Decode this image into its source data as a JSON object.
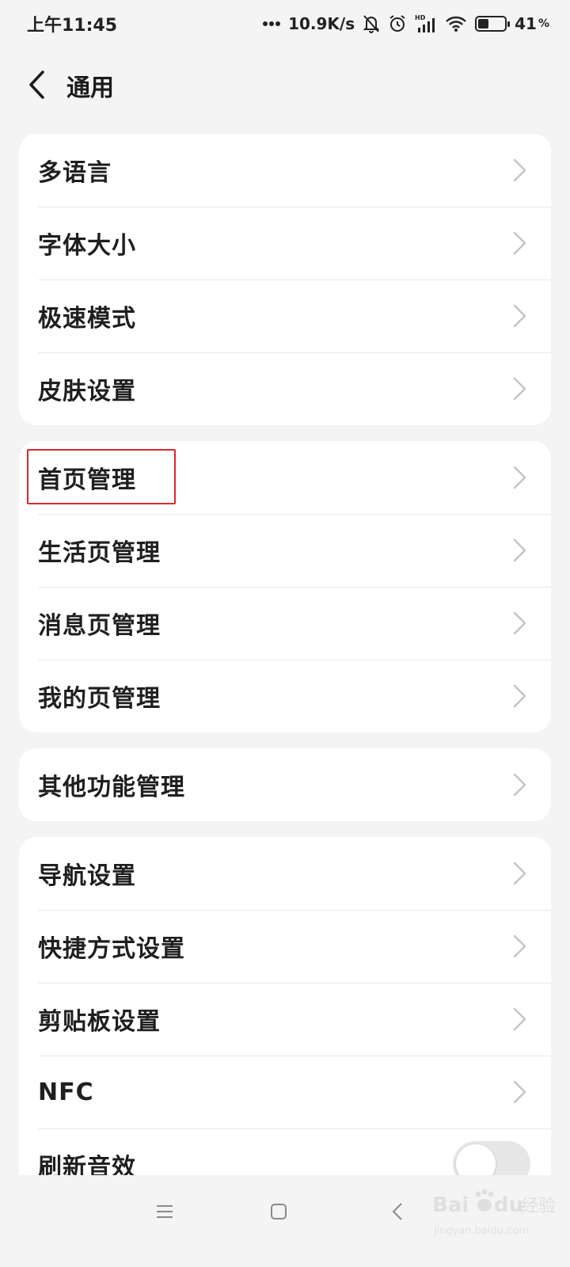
{
  "status_bar": {
    "time": "上午11:45",
    "network_speed": "10.9K/s",
    "battery_level": 41,
    "battery_text": "41",
    "percent_sign": "%",
    "icons": [
      "dots-icon",
      "mute-bell-icon",
      "alarm-icon",
      "hd-signal-icon",
      "wifi-icon",
      "battery-icon"
    ]
  },
  "header": {
    "title": "通用",
    "back_icon": "chevron-left-icon"
  },
  "groups": [
    {
      "items": [
        "多语言",
        "字体大小",
        "极速模式",
        "皮肤设置"
      ]
    },
    {
      "items": [
        "首页管理",
        "生活页管理",
        "消息页管理",
        "我的页管理"
      ]
    },
    {
      "items": [
        "其他功能管理"
      ]
    },
    {
      "items": [
        "导航设置",
        "快捷方式设置",
        "剪贴板设置",
        "NFC"
      ],
      "toggle_item": {
        "label": "刷新音效",
        "on": false
      }
    }
  ],
  "highlighted_item": "首页管理",
  "nav_bar": {
    "buttons": [
      "menu-icon",
      "home-square-icon",
      "back-chevron-icon"
    ]
  },
  "colors": {
    "background": "#f4f4f4",
    "card": "#ffffff",
    "highlight": "#d9282f",
    "chevron": "#c4c4c4"
  }
}
